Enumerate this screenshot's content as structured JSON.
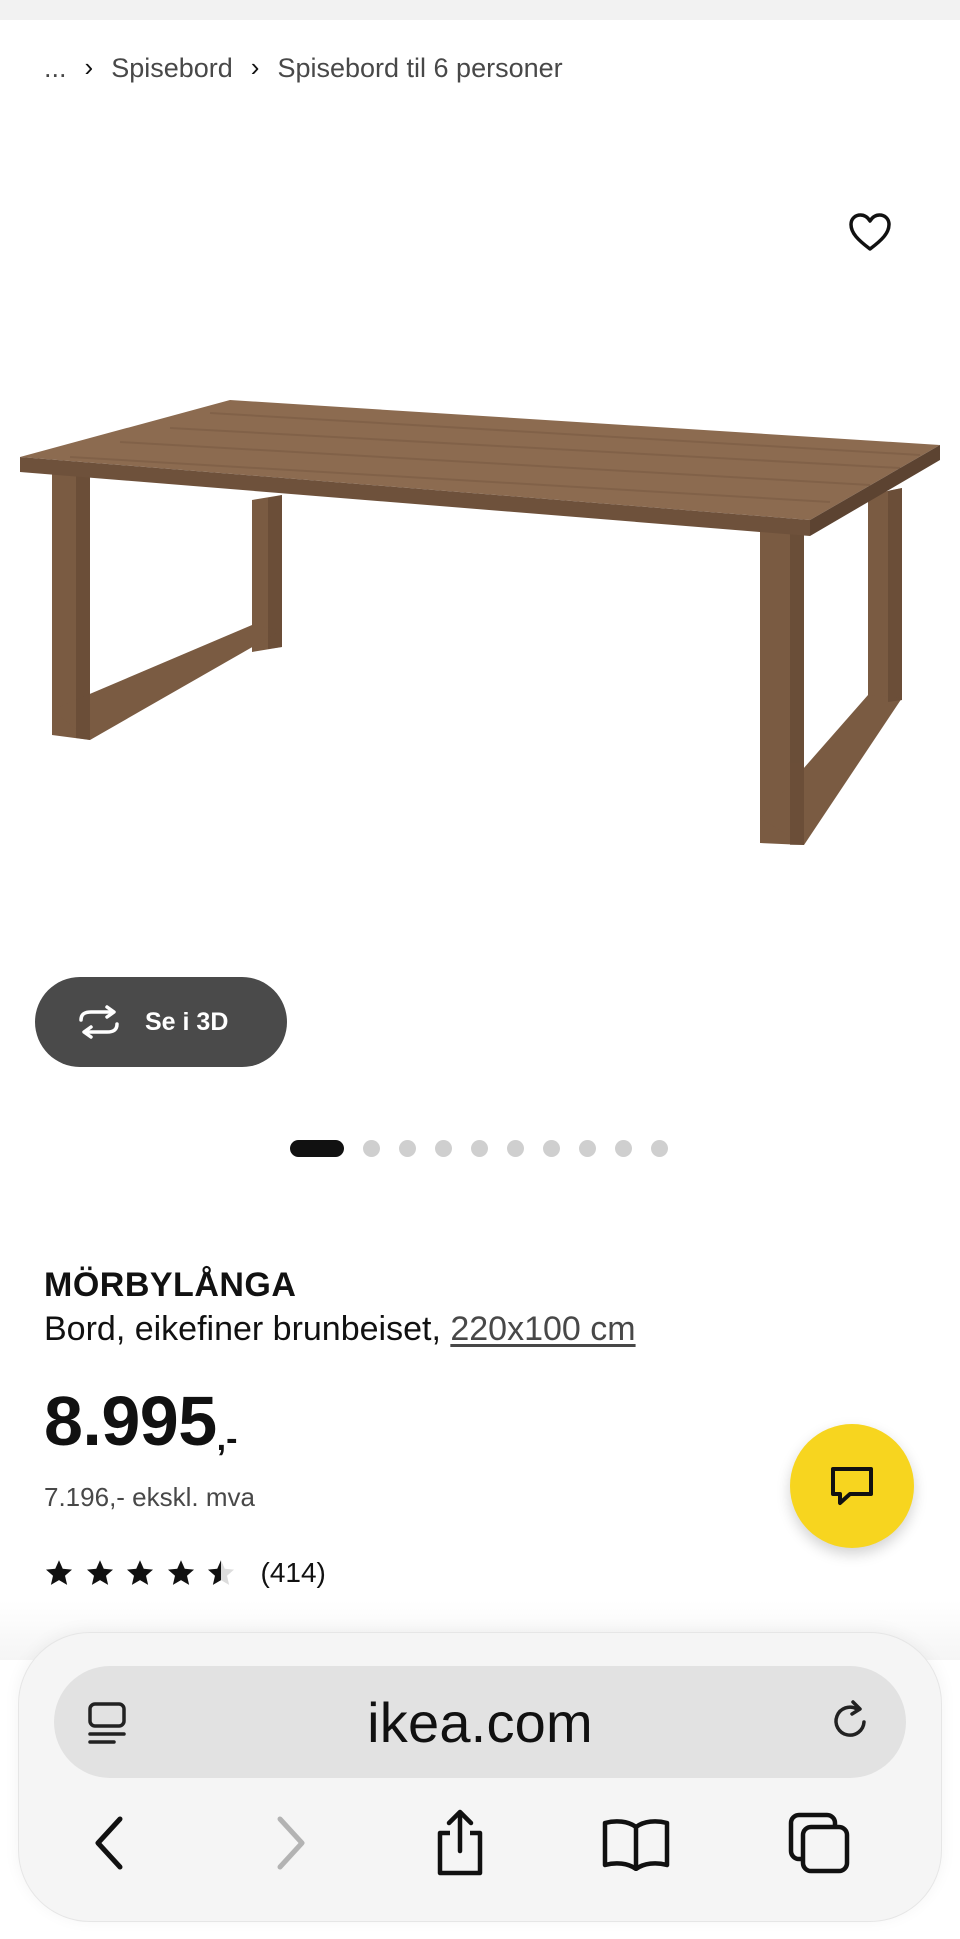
{
  "breadcrumb": {
    "ellipsis": "...",
    "items": [
      "Spisebord",
      "Spisebord til 6 personer"
    ]
  },
  "product": {
    "name": "MÖRBYLÅNGA",
    "description": "Bord, eikefiner brunbeiset, ",
    "size": "220x100 cm",
    "price_main": "8.995",
    "price_suffix": ",-",
    "price_excl": "7.196,- ekskl. mva",
    "rating_stars": 4.5,
    "review_count": "(414)"
  },
  "gallery": {
    "view_3d_label": "Se i 3D",
    "image_count": 10,
    "active_index": 0
  },
  "browser": {
    "url": "ikea.com"
  },
  "colors": {
    "ikea_yellow": "#f7d51f",
    "button_dark": "#4a4a4a",
    "wood": "#8a6a4e"
  },
  "icons": [
    "heart-icon",
    "rotate-3d-icon",
    "chat-icon",
    "star-icon",
    "reader-icon",
    "reload-icon",
    "back-icon",
    "forward-icon",
    "share-icon",
    "bookmarks-icon",
    "tabs-icon"
  ]
}
